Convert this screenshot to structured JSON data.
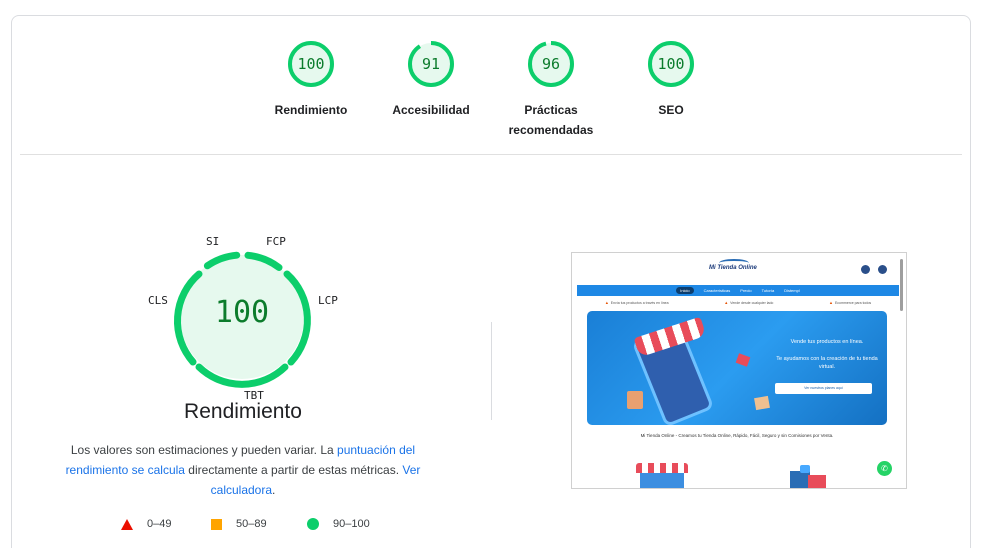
{
  "categories": [
    {
      "score": "100",
      "label": "Rendimiento",
      "fraction": 1.0
    },
    {
      "score": "91",
      "label": "Accesibilidad",
      "fraction": 0.91
    },
    {
      "score": "96",
      "label": "Prácticas recomendadas",
      "fraction": 0.96
    },
    {
      "score": "100",
      "label": "SEO",
      "fraction": 1.0
    }
  ],
  "performance": {
    "score": "100",
    "title": "Rendimiento",
    "metrics": {
      "si": "SI",
      "fcp": "FCP",
      "lcp": "LCP",
      "tbt": "TBT",
      "cls": "CLS"
    },
    "description_prefix": "Los valores son estimaciones y pueden variar. La ",
    "description_link1": "puntuación del rendimiento se calcula",
    "description_middle": " directamente a partir de estas métricas. ",
    "description_link2": "Ver calculadora",
    "description_suffix": "."
  },
  "legend": {
    "fail": "0–49",
    "average": "50–89",
    "pass": "90–100"
  },
  "colors": {
    "pass": "#0cce6b",
    "pass_text": "#0c7c2c",
    "pass_bg": "#e6f9ee",
    "average": "#ffa400",
    "fail": "#eb0f00",
    "link": "#1a73e8"
  },
  "preview": {
    "logo": "Mi Tienda Online",
    "nav": [
      "Inicio",
      "Características",
      "Precio",
      "Tutoría",
      "Distempl"
    ],
    "info": [
      "Envía tus productos a través en línea",
      "Vende desde cualquier lado",
      "Ecommerce para todos"
    ],
    "hero_title": "Vende tus productos en línea.",
    "hero_subtitle": "Te ayudamos con la creación de tu tienda virtual.",
    "hero_button": "Ver nuestros planes aquí",
    "tagline": "Mi Tienda Online - Creamos tu Tienda Online, Rápido, Fácil, Seguro y sin Comisiones por Venta.",
    "whatsapp_icon": "whatsapp-icon"
  }
}
